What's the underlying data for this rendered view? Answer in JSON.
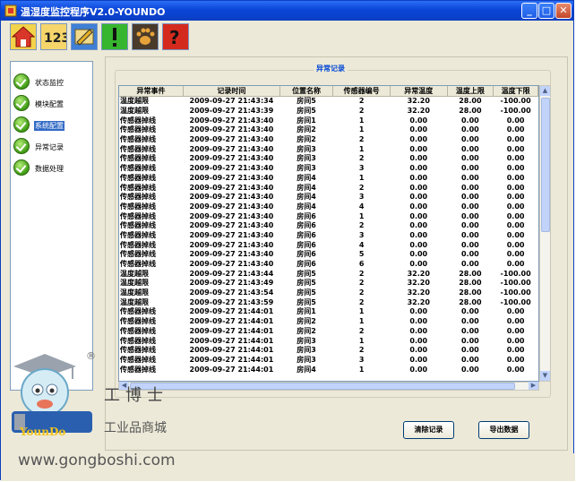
{
  "window": {
    "title": "温湿度监控程序V2.0-YOUNDO",
    "min_label": "_",
    "max_label": "□",
    "close_label": "✕"
  },
  "toolbar": {
    "icons": [
      "home-icon",
      "counter-icon",
      "pencil-icon",
      "exclamation-icon",
      "paw-icon",
      "help-icon"
    ]
  },
  "sidebar": {
    "items": [
      {
        "label": "状态监控"
      },
      {
        "label": "模块配置"
      },
      {
        "label": "系统配置"
      },
      {
        "label": "异常记录"
      },
      {
        "label": "数据处理"
      }
    ]
  },
  "panel": {
    "title": "异常记录"
  },
  "table": {
    "columns": [
      "异常事件",
      "记录时间",
      "位置名称",
      "传感器编号",
      "异常温度",
      "温度上限",
      "温度下限"
    ],
    "rows": [
      [
        "温度越限",
        "2009-09-27 21:43:34",
        "房间5",
        "2",
        "32.20",
        "28.00",
        "-100.00"
      ],
      [
        "温度越限",
        "2009-09-27 21:43:39",
        "房间5",
        "2",
        "32.20",
        "28.00",
        "-100.00"
      ],
      [
        "传感器掉线",
        "2009-09-27 21:43:40",
        "房间1",
        "1",
        "0.00",
        "0.00",
        "0.00"
      ],
      [
        "传感器掉线",
        "2009-09-27 21:43:40",
        "房间2",
        "1",
        "0.00",
        "0.00",
        "0.00"
      ],
      [
        "传感器掉线",
        "2009-09-27 21:43:40",
        "房间2",
        "2",
        "0.00",
        "0.00",
        "0.00"
      ],
      [
        "传感器掉线",
        "2009-09-27 21:43:40",
        "房间3",
        "1",
        "0.00",
        "0.00",
        "0.00"
      ],
      [
        "传感器掉线",
        "2009-09-27 21:43:40",
        "房间3",
        "2",
        "0.00",
        "0.00",
        "0.00"
      ],
      [
        "传感器掉线",
        "2009-09-27 21:43:40",
        "房间3",
        "3",
        "0.00",
        "0.00",
        "0.00"
      ],
      [
        "传感器掉线",
        "2009-09-27 21:43:40",
        "房间4",
        "1",
        "0.00",
        "0.00",
        "0.00"
      ],
      [
        "传感器掉线",
        "2009-09-27 21:43:40",
        "房间4",
        "2",
        "0.00",
        "0.00",
        "0.00"
      ],
      [
        "传感器掉线",
        "2009-09-27 21:43:40",
        "房间4",
        "3",
        "0.00",
        "0.00",
        "0.00"
      ],
      [
        "传感器掉线",
        "2009-09-27 21:43:40",
        "房间4",
        "4",
        "0.00",
        "0.00",
        "0.00"
      ],
      [
        "传感器掉线",
        "2009-09-27 21:43:40",
        "房间6",
        "1",
        "0.00",
        "0.00",
        "0.00"
      ],
      [
        "传感器掉线",
        "2009-09-27 21:43:40",
        "房间6",
        "2",
        "0.00",
        "0.00",
        "0.00"
      ],
      [
        "传感器掉线",
        "2009-09-27 21:43:40",
        "房间6",
        "3",
        "0.00",
        "0.00",
        "0.00"
      ],
      [
        "传感器掉线",
        "2009-09-27 21:43:40",
        "房间6",
        "4",
        "0.00",
        "0.00",
        "0.00"
      ],
      [
        "传感器掉线",
        "2009-09-27 21:43:40",
        "房间6",
        "5",
        "0.00",
        "0.00",
        "0.00"
      ],
      [
        "传感器掉线",
        "2009-09-27 21:43:40",
        "房间6",
        "6",
        "0.00",
        "0.00",
        "0.00"
      ],
      [
        "温度越限",
        "2009-09-27 21:43:44",
        "房间5",
        "2",
        "32.20",
        "28.00",
        "-100.00"
      ],
      [
        "温度越限",
        "2009-09-27 21:43:49",
        "房间5",
        "2",
        "32.20",
        "28.00",
        "-100.00"
      ],
      [
        "温度越限",
        "2009-09-27 21:43:54",
        "房间5",
        "2",
        "32.20",
        "28.00",
        "-100.00"
      ],
      [
        "温度越限",
        "2009-09-27 21:43:59",
        "房间5",
        "2",
        "32.20",
        "28.00",
        "-100.00"
      ],
      [
        "传感器掉线",
        "2009-09-27 21:44:01",
        "房间1",
        "1",
        "0.00",
        "0.00",
        "0.00"
      ],
      [
        "传感器掉线",
        "2009-09-27 21:44:01",
        "房间2",
        "1",
        "0.00",
        "0.00",
        "0.00"
      ],
      [
        "传感器掉线",
        "2009-09-27 21:44:01",
        "房间2",
        "2",
        "0.00",
        "0.00",
        "0.00"
      ],
      [
        "传感器掉线",
        "2009-09-27 21:44:01",
        "房间3",
        "1",
        "0.00",
        "0.00",
        "0.00"
      ],
      [
        "传感器掉线",
        "2009-09-27 21:44:01",
        "房间3",
        "2",
        "0.00",
        "0.00",
        "0.00"
      ],
      [
        "传感器掉线",
        "2009-09-27 21:44:01",
        "房间3",
        "3",
        "0.00",
        "0.00",
        "0.00"
      ],
      [
        "传感器掉线",
        "2009-09-27 21:44:01",
        "房间4",
        "1",
        "0.00",
        "0.00",
        "0.00"
      ]
    ]
  },
  "buttons": {
    "clear": "清除记录",
    "export": "导出数据"
  },
  "watermark": {
    "brand": "工博士",
    "mall": "工业品商城",
    "url": "www.gongboshi.com",
    "logo": "YounDo",
    "registered": "®"
  },
  "colors": {
    "titlebar": "#0a45d8",
    "panel_title": "#0046d5",
    "selection": "#316ac5"
  }
}
